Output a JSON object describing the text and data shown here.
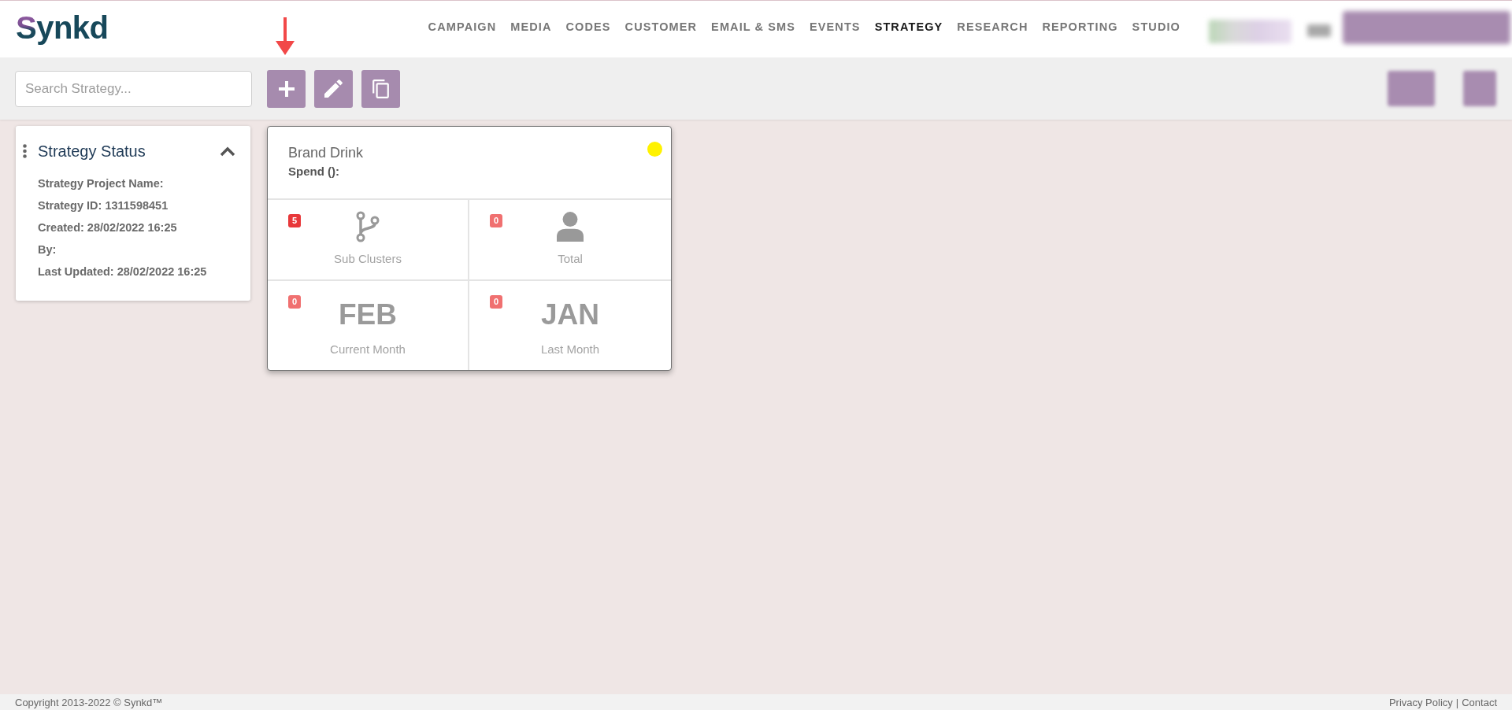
{
  "header": {
    "logo": "Synkd",
    "nav": [
      {
        "label": "CAMPAIGN",
        "selected": false
      },
      {
        "label": "MEDIA",
        "selected": false
      },
      {
        "label": "CODES",
        "selected": false
      },
      {
        "label": "CUSTOMER",
        "selected": false
      },
      {
        "label": "EMAIL & SMS",
        "selected": false
      },
      {
        "label": "EVENTS",
        "selected": false
      },
      {
        "label": "STRATEGY",
        "selected": true
      },
      {
        "label": "RESEARCH",
        "selected": false
      },
      {
        "label": "REPORTING",
        "selected": false
      },
      {
        "label": "STUDIO",
        "selected": false
      }
    ]
  },
  "toolbar": {
    "search": {
      "placeholder": "Search Strategy..."
    }
  },
  "status_panel": {
    "title": "Strategy Status",
    "expanded": true,
    "lines": [
      "Strategy Project Name:",
      "Strategy ID: 1311598451",
      "Created: 28/02/2022 16:25",
      "By:",
      "Last Updated: 28/02/2022 16:25"
    ]
  },
  "strategies": [
    {
      "name": "Brand Drink",
      "spend": "Spend ():",
      "color": "#fff200",
      "cells": [
        {
          "kind": "icon",
          "count": "5",
          "color": "#e8383a",
          "label": "Sub Clusters"
        },
        {
          "kind": "icon",
          "count": "0",
          "color": "#f07070",
          "label": "Total"
        },
        {
          "kind": "month",
          "count": "0",
          "color": "#f07070",
          "value": "FEB",
          "label": "Current Month"
        },
        {
          "kind": "month",
          "count": "0",
          "color": "#f07070",
          "value": "JAN",
          "label": "Last Month"
        }
      ]
    }
  ],
  "footer": {
    "copyright": "Copyright 2013-2022 © Synkd™",
    "links": [
      "Privacy Policy",
      "Contact"
    ],
    "separator": "|"
  }
}
